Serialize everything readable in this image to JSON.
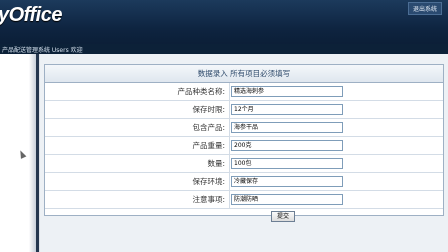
{
  "header": {
    "logo_text": "yOffice",
    "top_button": "退出系统",
    "subtitle": "产品配送管理系统 Users 欢迎"
  },
  "form": {
    "title": "数据录入 所有项目必须填写",
    "fields": [
      {
        "label": "产品种类名称:",
        "value": "精选海刺参"
      },
      {
        "label": "保存时限:",
        "value": "12个月"
      },
      {
        "label": "包含产品:",
        "value": "海参干品"
      },
      {
        "label": "产品重量:",
        "value": "200克"
      },
      {
        "label": "数量:",
        "value": "100包"
      },
      {
        "label": "保存环境:",
        "value": "冷藏保存"
      },
      {
        "label": "注意事项:",
        "value": "防潮防晒"
      }
    ],
    "submit_label": "提交"
  }
}
